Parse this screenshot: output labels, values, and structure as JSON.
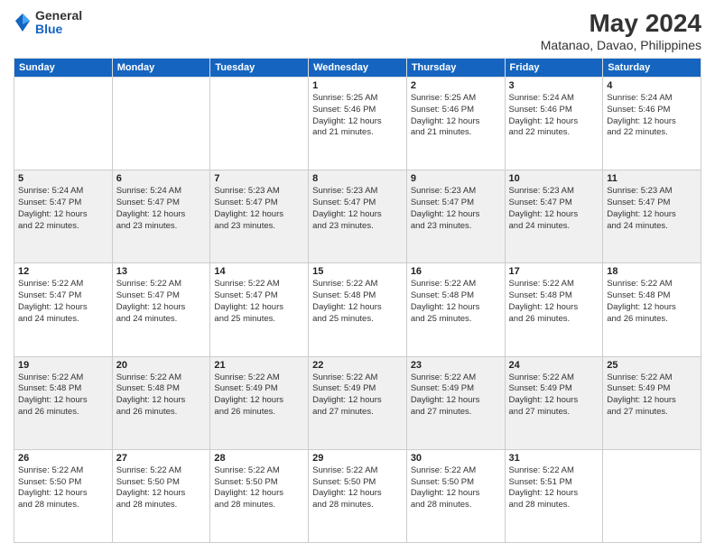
{
  "logo": {
    "general": "General",
    "blue": "Blue"
  },
  "title": "May 2024",
  "subtitle": "Matanao, Davao, Philippines",
  "headers": [
    "Sunday",
    "Monday",
    "Tuesday",
    "Wednesday",
    "Thursday",
    "Friday",
    "Saturday"
  ],
  "weeks": [
    [
      {
        "day": "",
        "info": ""
      },
      {
        "day": "",
        "info": ""
      },
      {
        "day": "",
        "info": ""
      },
      {
        "day": "1",
        "info": "Sunrise: 5:25 AM\nSunset: 5:46 PM\nDaylight: 12 hours\nand 21 minutes."
      },
      {
        "day": "2",
        "info": "Sunrise: 5:25 AM\nSunset: 5:46 PM\nDaylight: 12 hours\nand 21 minutes."
      },
      {
        "day": "3",
        "info": "Sunrise: 5:24 AM\nSunset: 5:46 PM\nDaylight: 12 hours\nand 22 minutes."
      },
      {
        "day": "4",
        "info": "Sunrise: 5:24 AM\nSunset: 5:46 PM\nDaylight: 12 hours\nand 22 minutes."
      }
    ],
    [
      {
        "day": "5",
        "info": "Sunrise: 5:24 AM\nSunset: 5:47 PM\nDaylight: 12 hours\nand 22 minutes."
      },
      {
        "day": "6",
        "info": "Sunrise: 5:24 AM\nSunset: 5:47 PM\nDaylight: 12 hours\nand 23 minutes."
      },
      {
        "day": "7",
        "info": "Sunrise: 5:23 AM\nSunset: 5:47 PM\nDaylight: 12 hours\nand 23 minutes."
      },
      {
        "day": "8",
        "info": "Sunrise: 5:23 AM\nSunset: 5:47 PM\nDaylight: 12 hours\nand 23 minutes."
      },
      {
        "day": "9",
        "info": "Sunrise: 5:23 AM\nSunset: 5:47 PM\nDaylight: 12 hours\nand 23 minutes."
      },
      {
        "day": "10",
        "info": "Sunrise: 5:23 AM\nSunset: 5:47 PM\nDaylight: 12 hours\nand 24 minutes."
      },
      {
        "day": "11",
        "info": "Sunrise: 5:23 AM\nSunset: 5:47 PM\nDaylight: 12 hours\nand 24 minutes."
      }
    ],
    [
      {
        "day": "12",
        "info": "Sunrise: 5:22 AM\nSunset: 5:47 PM\nDaylight: 12 hours\nand 24 minutes."
      },
      {
        "day": "13",
        "info": "Sunrise: 5:22 AM\nSunset: 5:47 PM\nDaylight: 12 hours\nand 24 minutes."
      },
      {
        "day": "14",
        "info": "Sunrise: 5:22 AM\nSunset: 5:47 PM\nDaylight: 12 hours\nand 25 minutes."
      },
      {
        "day": "15",
        "info": "Sunrise: 5:22 AM\nSunset: 5:48 PM\nDaylight: 12 hours\nand 25 minutes."
      },
      {
        "day": "16",
        "info": "Sunrise: 5:22 AM\nSunset: 5:48 PM\nDaylight: 12 hours\nand 25 minutes."
      },
      {
        "day": "17",
        "info": "Sunrise: 5:22 AM\nSunset: 5:48 PM\nDaylight: 12 hours\nand 26 minutes."
      },
      {
        "day": "18",
        "info": "Sunrise: 5:22 AM\nSunset: 5:48 PM\nDaylight: 12 hours\nand 26 minutes."
      }
    ],
    [
      {
        "day": "19",
        "info": "Sunrise: 5:22 AM\nSunset: 5:48 PM\nDaylight: 12 hours\nand 26 minutes."
      },
      {
        "day": "20",
        "info": "Sunrise: 5:22 AM\nSunset: 5:48 PM\nDaylight: 12 hours\nand 26 minutes."
      },
      {
        "day": "21",
        "info": "Sunrise: 5:22 AM\nSunset: 5:49 PM\nDaylight: 12 hours\nand 26 minutes."
      },
      {
        "day": "22",
        "info": "Sunrise: 5:22 AM\nSunset: 5:49 PM\nDaylight: 12 hours\nand 27 minutes."
      },
      {
        "day": "23",
        "info": "Sunrise: 5:22 AM\nSunset: 5:49 PM\nDaylight: 12 hours\nand 27 minutes."
      },
      {
        "day": "24",
        "info": "Sunrise: 5:22 AM\nSunset: 5:49 PM\nDaylight: 12 hours\nand 27 minutes."
      },
      {
        "day": "25",
        "info": "Sunrise: 5:22 AM\nSunset: 5:49 PM\nDaylight: 12 hours\nand 27 minutes."
      }
    ],
    [
      {
        "day": "26",
        "info": "Sunrise: 5:22 AM\nSunset: 5:50 PM\nDaylight: 12 hours\nand 28 minutes."
      },
      {
        "day": "27",
        "info": "Sunrise: 5:22 AM\nSunset: 5:50 PM\nDaylight: 12 hours\nand 28 minutes."
      },
      {
        "day": "28",
        "info": "Sunrise: 5:22 AM\nSunset: 5:50 PM\nDaylight: 12 hours\nand 28 minutes."
      },
      {
        "day": "29",
        "info": "Sunrise: 5:22 AM\nSunset: 5:50 PM\nDaylight: 12 hours\nand 28 minutes."
      },
      {
        "day": "30",
        "info": "Sunrise: 5:22 AM\nSunset: 5:50 PM\nDaylight: 12 hours\nand 28 minutes."
      },
      {
        "day": "31",
        "info": "Sunrise: 5:22 AM\nSunset: 5:51 PM\nDaylight: 12 hours\nand 28 minutes."
      },
      {
        "day": "",
        "info": ""
      }
    ]
  ]
}
